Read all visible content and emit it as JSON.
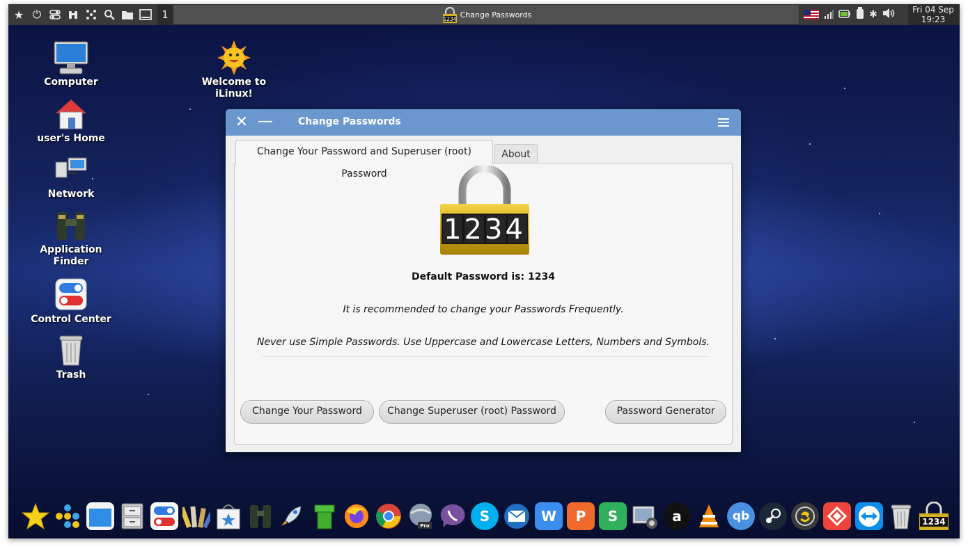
{
  "top_panel": {
    "workspace": "1",
    "task_title": "Change Passwords",
    "clock": {
      "date": "Fri 04 Sep",
      "time": "19:23"
    }
  },
  "desktop_icons": [
    {
      "label": "Computer"
    },
    {
      "label": "user's Home"
    },
    {
      "label": "Network"
    },
    {
      "label": "Application Finder"
    },
    {
      "label": "Control Center"
    },
    {
      "label": "Trash"
    },
    {
      "label": "Welcome to iLinux!"
    }
  ],
  "window": {
    "title": "Change Passwords",
    "tabs": [
      {
        "label": "Change Your Password and Superuser (root) Password",
        "active": true
      },
      {
        "label": "About",
        "active": false
      }
    ],
    "lock_code": "1234",
    "default_password_text": "Default Password is: 1234",
    "recommend_text": "It is recommended to change your Passwords Frequently.",
    "tip_text": "Never use Simple Passwords. Use Uppercase and Lowercase Letters, Numbers and Symbols.",
    "buttons": {
      "change_password": "Change Your Password",
      "change_root": "Change Superuser (root) Password",
      "generator": "Password Generator"
    }
  },
  "dock": {
    "lock_label": "1234",
    "items": [
      "favorites",
      "app-grid",
      "desktop",
      "file-manager",
      "control-center",
      "color-palette",
      "software-store",
      "app-finder",
      "rocket",
      "pipe",
      "firefox",
      "chrome",
      "google-earth-pro",
      "viber",
      "skype",
      "mail",
      "writer",
      "presentation",
      "spreadsheet",
      "screenshot",
      "anydesk",
      "vlc",
      "qbittorrent",
      "steam",
      "timeshift",
      "anydesk-remote",
      "teamviewer",
      "trash",
      "change-passwords"
    ]
  },
  "colors": {
    "titlebar": "#6b97cf",
    "panel": "#2c2c2c"
  }
}
